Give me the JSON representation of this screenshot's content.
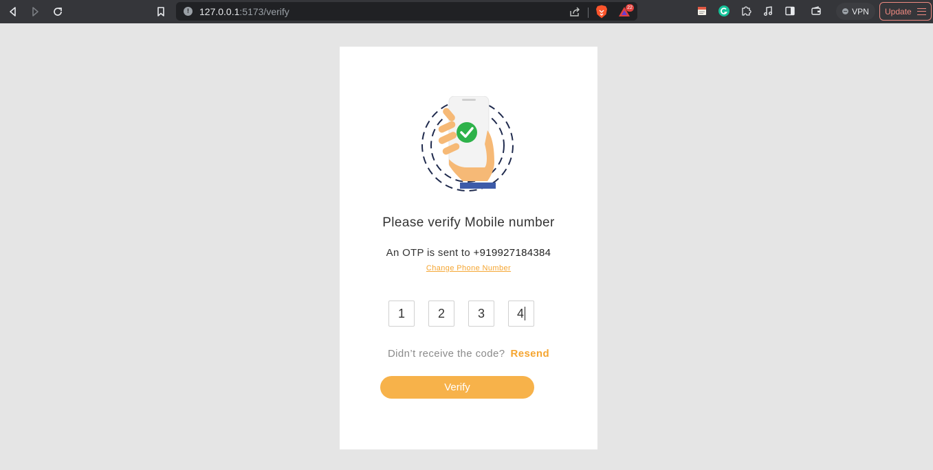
{
  "browser": {
    "url_host": "127.0.0.1",
    "url_path": ":5173/verify",
    "notification_count": "22",
    "vpn_label": "VPN",
    "update_label": "Update"
  },
  "verify": {
    "title": "Please verify Mobile number",
    "otp_sent_prefix": "An OTP is sent to",
    "phone_number": "+919927184384",
    "change_phone_link": "Change Phone Number",
    "otp_digits": [
      "1",
      "2",
      "3",
      "4"
    ],
    "resend_question": "Didn’t receive the code?",
    "resend_link": "Resend",
    "verify_button": "Verify"
  },
  "colors": {
    "accent": "#f7b24a",
    "link": "#f5a530",
    "check": "#2eb24a",
    "chrome_bg": "#35363a"
  }
}
